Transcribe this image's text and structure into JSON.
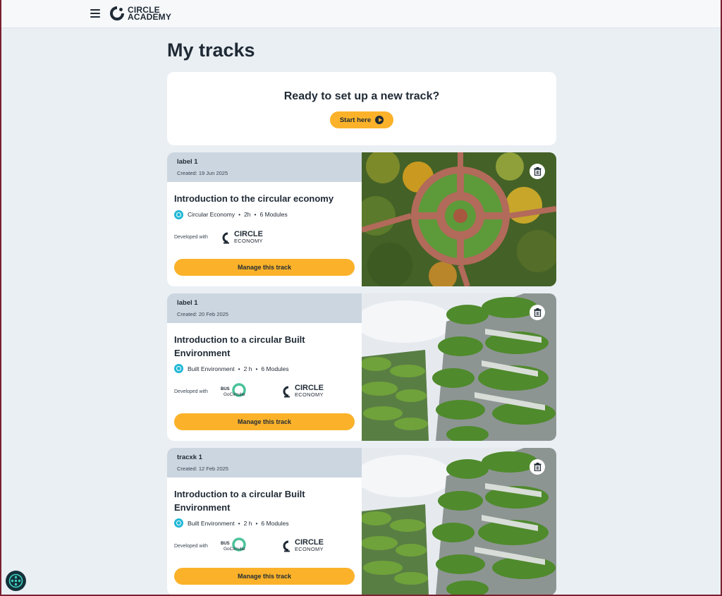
{
  "app": {
    "logo_line1": "CIRCLE",
    "logo_line2": "ACADEMY"
  },
  "page": {
    "title": "My tracks"
  },
  "hero": {
    "heading": "Ready to set up a new track?",
    "button_label": "Start here"
  },
  "common": {
    "developed_with": "Developed with",
    "manage_label": "Manage this track",
    "ce_line1": "CIRCLE",
    "ce_line2": "ECONOMY",
    "bus_text": "BUS",
    "go_text": "GoCircular"
  },
  "tracks": [
    {
      "label": "label 1",
      "created": "Created: 19 Jun 2025",
      "title": "Introduction to the circular economy",
      "topic": "Circular Economy",
      "duration": "2h",
      "modules": "6 Modules",
      "image": "aerial-park"
    },
    {
      "label": "label 1",
      "created": "Created: 20 Feb 2025",
      "title": "Introduction to a circular Built Environment",
      "topic": "Built Environment",
      "duration": "2 h",
      "modules": "6 Modules",
      "image": "vertical-forest"
    },
    {
      "label": "tracxk 1",
      "created": "Created: 12 Feb 2025",
      "title": "Introduction to a circular Built Environment",
      "topic": "Built Environment",
      "duration": "2 h",
      "modules": "6 Modules",
      "image": "vertical-forest"
    }
  ],
  "colors": {
    "accent": "#fbb22a",
    "background": "#eaeff4",
    "card_header": "#ccd6e0",
    "topic_icon": "#22b8d6",
    "text": "#1f2a35"
  },
  "icons": [
    "menu-icon",
    "logo-icon",
    "play-icon",
    "topic-icon",
    "trash-icon",
    "helper-icon"
  ]
}
